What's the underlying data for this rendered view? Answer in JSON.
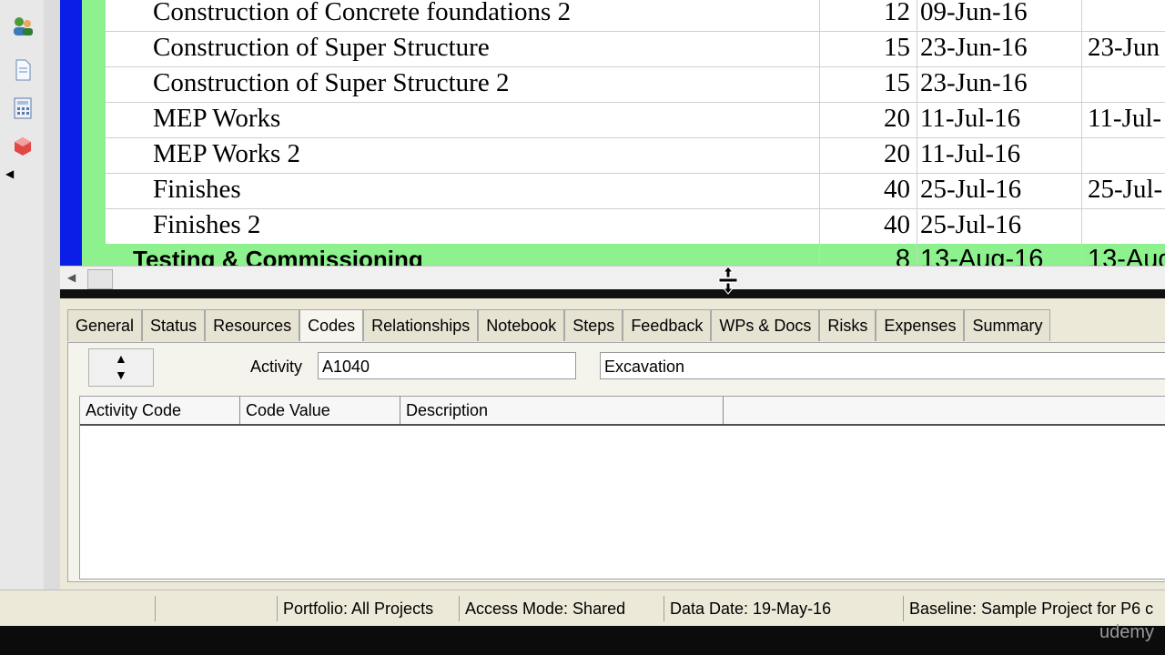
{
  "grid": {
    "rows": [
      {
        "name": "Construction of Concrete foundations 2",
        "duration": "12",
        "start": "09-Jun-16",
        "finish": ""
      },
      {
        "name": "Construction of Super Structure",
        "duration": "15",
        "start": "23-Jun-16",
        "finish": "23-Jun"
      },
      {
        "name": "Construction of Super Structure 2",
        "duration": "15",
        "start": "23-Jun-16",
        "finish": ""
      },
      {
        "name": "MEP Works",
        "duration": "20",
        "start": "11-Jul-16",
        "finish": "11-Jul-"
      },
      {
        "name": "MEP Works 2",
        "duration": "20",
        "start": "11-Jul-16",
        "finish": ""
      },
      {
        "name": "Finishes",
        "duration": "40",
        "start": "25-Jul-16",
        "finish": "25-Jul-"
      },
      {
        "name": "Finishes 2",
        "duration": "40",
        "start": "25-Jul-16",
        "finish": ""
      }
    ],
    "wbs_row": {
      "name": "Testing & Commissioning",
      "duration": "8",
      "start": "13-Aug-16",
      "finish": "13-Aug"
    }
  },
  "details": {
    "tabs": [
      "General",
      "Status",
      "Resources",
      "Codes",
      "Relationships",
      "Notebook",
      "Steps",
      "Feedback",
      "WPs & Docs",
      "Risks",
      "Expenses",
      "Summary"
    ],
    "active_tab": "Codes",
    "activity_label": "Activity",
    "activity_id": "A1040",
    "activity_name": "Excavation",
    "columns": [
      "Activity Code",
      "Code Value",
      "Description"
    ]
  },
  "statusbar": {
    "portfolio": "Portfolio: All Projects",
    "access_mode": "Access Mode: Shared",
    "data_date": "Data Date: 19-May-16",
    "baseline": "Baseline: Sample Project for P6 c"
  },
  "watermark": "udemy",
  "colors": {
    "wbs_green": "#8df28d",
    "blue_band": "#0a1ee6"
  }
}
